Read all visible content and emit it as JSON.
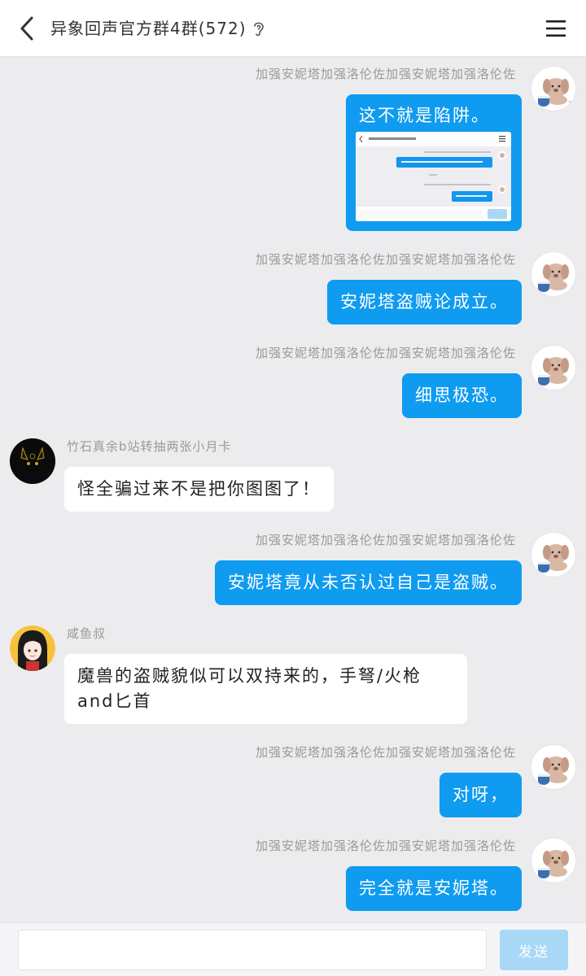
{
  "header": {
    "title": "异象回声官方群4群(572)",
    "back_icon": "chevron-left-icon",
    "ear_icon": "ear-icon",
    "menu_icon": "hamburger-menu-icon"
  },
  "messages": [
    {
      "sender": "加强安妮塔加强洛伦佐加强安妮塔加强洛伦佐",
      "text": "这不就是陷阱。",
      "attachment": "screenshot-image"
    },
    {
      "sender": "加强安妮塔加强洛伦佐加强安妮塔加强洛伦佐",
      "text": "安妮塔盗贼论成立。"
    },
    {
      "sender": "加强安妮塔加强洛伦佐加强安妮塔加强洛伦佐",
      "text": "细思极恐。"
    },
    {
      "sender": "竹石真余b站转抽两张小月卡",
      "text": "怪全骗过来不是把你图图了！"
    },
    {
      "sender": "加强安妮塔加强洛伦佐加强安妮塔加强洛伦佐",
      "text": "安妮塔竟从未否认过自己是盗贼。"
    },
    {
      "sender": "咸鱼叔",
      "text": "魔兽的盗贼貌似可以双持来的，手弩/火枪and匕首"
    },
    {
      "sender": "加强安妮塔加强洛伦佐加强安妮塔加强洛伦佐",
      "text": "对呀，"
    },
    {
      "sender": "加强安妮塔加强洛伦佐加强安妮塔加强洛伦佐",
      "text": "完全就是安妮塔。"
    }
  ],
  "input": {
    "value": "",
    "send_label": "发送"
  },
  "colors": {
    "my_bubble": "#0f9bf0",
    "other_bubble": "#ffffff",
    "background": "#ececef",
    "send_disabled": "#a9d8f6"
  }
}
